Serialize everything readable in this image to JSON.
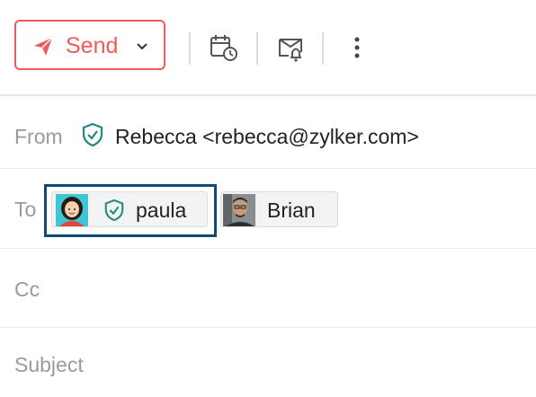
{
  "toolbar": {
    "send_label": "Send",
    "icons": [
      "paper-plane-icon",
      "chevron-down-icon",
      "schedule-send-icon",
      "reminder-icon",
      "more-options-icon"
    ]
  },
  "from": {
    "label": "From",
    "value": "Rebecca <rebecca@zylker.com>"
  },
  "to": {
    "label": "To",
    "recipients": [
      {
        "name": "paula",
        "verified": true
      },
      {
        "name": "Brian",
        "verified": false
      }
    ]
  },
  "cc": {
    "label": "Cc"
  },
  "subject": {
    "label": "Subject"
  },
  "colors": {
    "accent": "#ef5b5b",
    "verified": "#1f8a7a",
    "focus": "#0e4a73",
    "label_gray": "#9a9a9a"
  }
}
